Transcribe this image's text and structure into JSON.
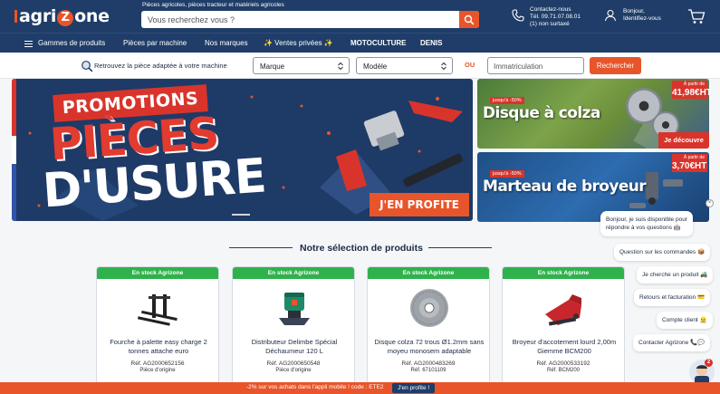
{
  "header": {
    "logo_left": "agri",
    "logo_z": "Z",
    "logo_right": "one",
    "tagline": "Pièces agricoles, pièces tracteur et matériels agricoles",
    "search_placeholder": "Vous recherchez vous ?",
    "contact": {
      "line1": "Contactez-nous",
      "line2": "Tél. 09.71.07.08.01",
      "line3": "(1) non surtaxé"
    },
    "account": {
      "line1": "Bonjour,",
      "line2": "Identifiez-vous"
    }
  },
  "nav": {
    "items": [
      "Gammes de produits",
      "Pièces par machine",
      "Nos marques",
      "✨ Ventes privées ✨",
      "MOTOCULTURE",
      "DENIS"
    ]
  },
  "finder": {
    "label": "Retrouvez la pièce adaptée à votre machine",
    "brand_select": "Marque",
    "model_select": "Modèle",
    "or": "OU",
    "plate_placeholder": "Immatriculation",
    "button": "Rechercher"
  },
  "hero": {
    "tag": "PROMOTIONS",
    "line1": "PIÈCES",
    "line2": "D'USURE",
    "cta": "J'EN PROFITE"
  },
  "side_banners": [
    {
      "badge": "jusqu'à -50%",
      "title": "Disque à colza",
      "price_prefix": "À partir de",
      "price": "41,98€HT",
      "cta": "Je découvre"
    },
    {
      "badge": "jusqu'à -50%",
      "title": "Marteau de broyeur",
      "price_prefix": "À partir de",
      "price": "3,70€HT"
    }
  ],
  "products_section": {
    "title": "Notre sélection de produits"
  },
  "products": [
    {
      "stock": "En stock Agrizone",
      "name": "Fourche à palette easy charge 2 tonnes attache euro",
      "ref": "Réf. AG2000652156",
      "origin": "Pièce d'origine",
      "icon": "pallet-fork"
    },
    {
      "stock": "En stock Agrizone",
      "name": "Distributeur Delimbe Spécial Déchaumeur 120 L",
      "ref": "Réf. AG2000650548",
      "origin": "Pièce d'origine",
      "icon": "seed-distributor"
    },
    {
      "stock": "En stock Agrizone",
      "name": "Disque colza 72 trous Ø1.2mm sans moyeu monosem adaptable",
      "ref": "Réf. AG2000483269",
      "origin": "Réf. 67101109",
      "icon": "seed-disc"
    },
    {
      "stock": "En stock Agrizone",
      "name": "Broyeur d'accotement lourd 2,00m Giemme BCM200",
      "ref": "Réf. AG2000533192",
      "origin": "Réf. BCM200",
      "icon": "flail-mower"
    }
  ],
  "chat": {
    "greeting_line1": "Bonjour, je suis disponible pour",
    "greeting_line2": "répondre à vos questions 🤖",
    "options": [
      "Question sur les commandes 📦",
      "Je cherche un produit 🚜",
      "Retours et facturation 💳",
      "Compte client 👷",
      "Contacter Agrizone 📞💬"
    ],
    "close": "×",
    "badge_count": "2"
  },
  "bottom_banner": {
    "text": "-2% sur vos achats dans l'appli mobile ! code : ETE2",
    "button": "J'en profite !"
  },
  "colors": {
    "navy": "#1f3d68",
    "accent": "#e8552a",
    "red": "#d9342b",
    "stock_green": "#2fb24c"
  }
}
